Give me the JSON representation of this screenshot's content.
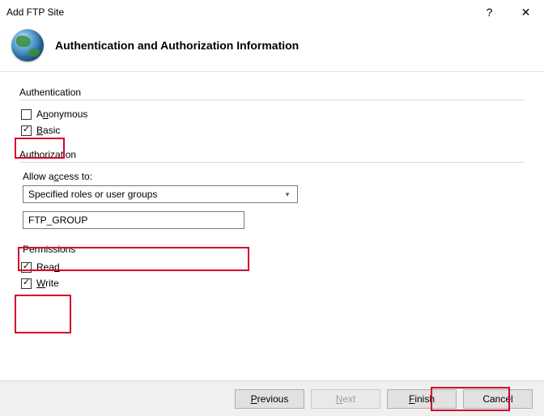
{
  "window": {
    "title": "Add FTP Site",
    "help": "?",
    "close": "✕"
  },
  "header": {
    "heading": "Authentication and Authorization Information"
  },
  "auth_group": {
    "title": "Authentication",
    "anonymous": {
      "label_pre": "A",
      "label_ul": "n",
      "label_post": "onymous",
      "checked": false
    },
    "basic": {
      "label_ul": "B",
      "label_post": "asic",
      "checked": true
    }
  },
  "authz_group": {
    "title": "Authorization",
    "allow_label_pre": "Allow a",
    "allow_label_ul": "c",
    "allow_label_post": "cess to:",
    "select_value": "Specified roles or user groups",
    "textbox_value": "FTP_GROUP"
  },
  "perm_group": {
    "title": "Permissions",
    "read": {
      "label_pre": "Rea",
      "label_ul": "d",
      "checked": true
    },
    "write": {
      "label_ul": "W",
      "label_post": "rite",
      "checked": true
    }
  },
  "footer": {
    "previous_ul": "P",
    "previous_post": "revious",
    "next_ul": "N",
    "next_post": "ext",
    "finish_ul": "F",
    "finish_post": "inish",
    "cancel": "Cancel"
  }
}
